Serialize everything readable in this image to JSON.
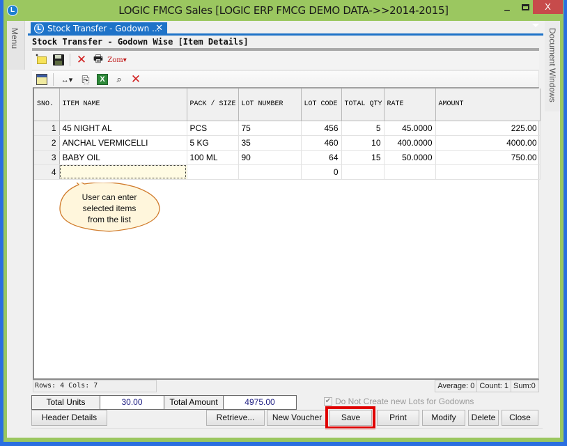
{
  "window": {
    "title": "LOGIC FMCG Sales  [LOGIC ERP FMCG DEMO DATA->>2014-2015]",
    "app_icon": "L",
    "minimize_label": "‒",
    "close_label": "X"
  },
  "side_panels": {
    "left_label": "Menu",
    "right_label": "Document Windows"
  },
  "tab": {
    "label": "Stock Transfer - Godown ...",
    "close_label": "✕",
    "icon": "L"
  },
  "form": {
    "title": "Stock Transfer - Godown Wise [Item Details]"
  },
  "toolbar1": {
    "items": [
      {
        "name": "new-icon"
      },
      {
        "name": "save-icon"
      },
      {
        "name": "delete-icon",
        "glyph": "✕"
      },
      {
        "name": "print-icon",
        "glyph": "🖶"
      },
      {
        "name": "zoom-dropdown-icon",
        "glyph": "Zom▾"
      }
    ]
  },
  "toolbar2": {
    "items": [
      {
        "name": "layout-icon"
      },
      {
        "name": "column-width-dropdown-icon",
        "glyph": "↔▾"
      },
      {
        "name": "copy-icon",
        "glyph": "⎘"
      },
      {
        "name": "excel-export-icon",
        "glyph": "X"
      },
      {
        "name": "find-binoculars-icon",
        "glyph": "⌕"
      },
      {
        "name": "remove-icon",
        "glyph": "✕"
      }
    ]
  },
  "grid": {
    "columns": [
      {
        "key": "sno",
        "label": "SNO."
      },
      {
        "key": "item_name",
        "label": "ITEM NAME"
      },
      {
        "key": "pack_size",
        "label": "PACK / SIZE"
      },
      {
        "key": "lot_number",
        "label": "LOT NUMBER"
      },
      {
        "key": "lot_code",
        "label": "LOT CODE"
      },
      {
        "key": "total_qty",
        "label": "TOTAL QTY"
      },
      {
        "key": "rate",
        "label": "RATE"
      },
      {
        "key": "amount",
        "label": "AMOUNT"
      }
    ],
    "rows": [
      {
        "sno": "1",
        "item_name": "45 NIGHT AL",
        "pack_size": "PCS",
        "lot_number": "75",
        "lot_code": "456",
        "total_qty": "5",
        "rate": "45.0000",
        "amount": "225.00"
      },
      {
        "sno": "2",
        "item_name": "ANCHAL VERMICELLI",
        "pack_size": "5 KG",
        "lot_number": "35",
        "lot_code": "460",
        "total_qty": "10",
        "rate": "400.0000",
        "amount": "4000.00"
      },
      {
        "sno": "3",
        "item_name": "BABY OIL",
        "pack_size": "100 ML",
        "lot_number": "90",
        "lot_code": "64",
        "total_qty": "15",
        "rate": "50.0000",
        "amount": "750.00"
      },
      {
        "sno": "4",
        "item_name": "",
        "pack_size": "",
        "lot_number": "",
        "lot_code": "0",
        "total_qty": "",
        "rate": "",
        "amount": ""
      }
    ]
  },
  "callout": {
    "text": "User can enter selected items from the list",
    "line1": "User can enter",
    "line2": "selected items",
    "line3": "from the list"
  },
  "status": {
    "rows_cols": "Rows: 4  Cols: 7",
    "average": "Average: 0",
    "count": "Count: 1",
    "sum": "Sum:0"
  },
  "totals": {
    "units_label": "Total Units",
    "units_value": "30.00",
    "amount_label": "Total Amount",
    "amount_value": "4975.00"
  },
  "options": {
    "no_new_lots_label": "Do Not Create new Lots for Godowns",
    "no_new_lots_checked": true,
    "check_glyph": "✔"
  },
  "buttons": {
    "header_details": "Header Details",
    "retrieve": "Retrieve...",
    "new_voucher": "New Voucher",
    "save": "Save",
    "print": "Print",
    "modify": "Modify",
    "delete": "Delete",
    "close": "Close"
  },
  "colors": {
    "frame_green": "#9bc760",
    "outer_blue": "#2a6fe0",
    "tab_blue": "#1e73c8",
    "highlight_red": "#e00000",
    "callout_fill": "#fff6dc",
    "callout_stroke": "#d07a2a"
  }
}
